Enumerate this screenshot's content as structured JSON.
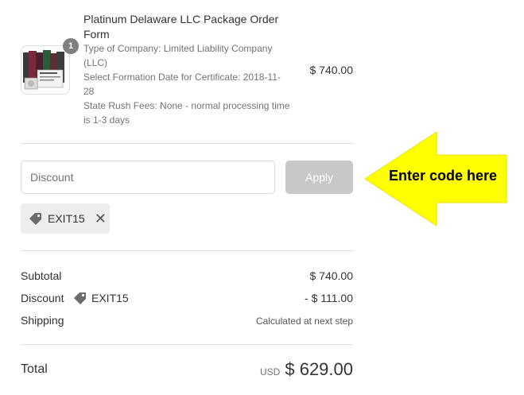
{
  "product": {
    "title": "Platinum Delaware LLC Package Order Form",
    "quantity": "1",
    "company_type": "Type of Company: Limited Liability Company (LLC)",
    "formation_date": "Select Formation Date for Certificate: 2018-11-28",
    "rush_fees": "State Rush Fees: None - normal processing time is 1-3 days",
    "price": "$ 740.00"
  },
  "discount": {
    "placeholder": "Discount",
    "apply_label": "Apply",
    "applied_code": "EXIT15"
  },
  "annotation": {
    "text": "Enter code here",
    "color": "#ffff00"
  },
  "summary": {
    "subtotal_label": "Subtotal",
    "subtotal_value": "$ 740.00",
    "discount_label": "Discount",
    "discount_code": "EXIT15",
    "discount_value": "- $ 111.00",
    "shipping_label": "Shipping",
    "shipping_value": "Calculated at next step",
    "total_label": "Total",
    "currency": "USD",
    "total_value": "$ 629.00"
  }
}
